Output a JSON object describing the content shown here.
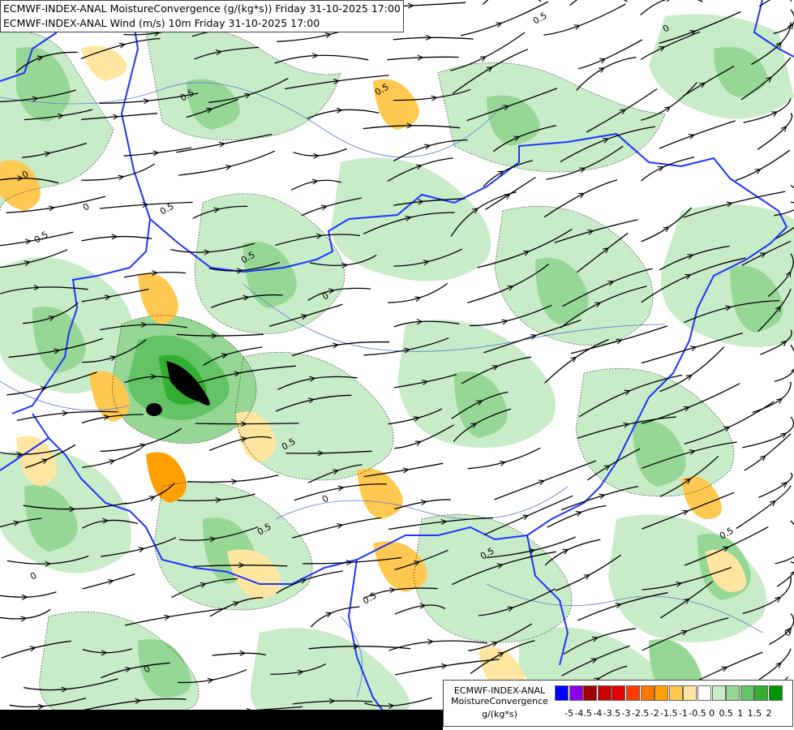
{
  "header": {
    "line1": "ECMWF-INDEX-ANAL MoistureConvergence (g/(kg*s)) Friday 31-10-2025 17:00",
    "line2": "ECMWF-INDEX-ANAL Wind (m/s) 10m Friday 31-10-2025 17:00"
  },
  "legend": {
    "model": "ECMWF-INDEX-ANAL",
    "field": "MoistureConvergence",
    "unit": "g/(kg*s)",
    "colors": [
      "#0000ff",
      "#8a00e6",
      "#a00000",
      "#c80000",
      "#e60000",
      "#ff3c00",
      "#ff7800",
      "#ffa000",
      "#ffc850",
      "#ffe6a0",
      "#ffffff",
      "#c8ebc8",
      "#96d796",
      "#64c364",
      "#32af32",
      "#009600"
    ],
    "ticks": [
      "-5",
      "-4.5",
      "-4",
      "-3.5",
      "-3",
      "-2.5",
      "-2",
      "-1.5",
      "-1",
      "-0.5",
      "0",
      "0.5",
      "1",
      "1.5",
      "2"
    ]
  },
  "map": {
    "contour_labels": [
      "0.5",
      "0",
      "0.5",
      "0.5",
      "0",
      "0.5",
      "0.5",
      "0",
      "0.5",
      "0",
      "0.5",
      "0",
      "0.5",
      "0.5",
      "0.5",
      "0",
      "0.5",
      "0",
      "0"
    ]
  }
}
